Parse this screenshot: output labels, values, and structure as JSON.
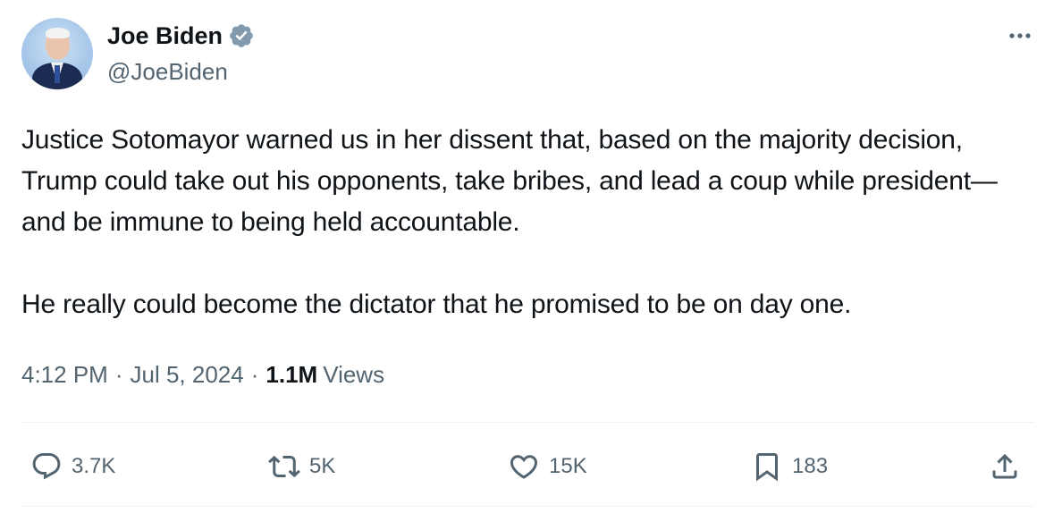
{
  "author": {
    "display_name": "Joe Biden",
    "handle": "@JoeBiden",
    "verified": true,
    "verified_color": "#829aab"
  },
  "tweet": {
    "paragraphs": [
      "Justice Sotomayor warned us in her dissent that, based on the majority decision, Trump could take out his opponents, take bribes, and lead a coup while president—and be immune to being held accountable.",
      "He really could become the dictator that he promised to be on day one."
    ],
    "time": "4:12 PM",
    "separator": "·",
    "date": "Jul 5, 2024",
    "views_count": "1.1M",
    "views_label": "Views"
  },
  "actions": {
    "reply": {
      "icon": "reply-icon",
      "count": "3.7K"
    },
    "repost": {
      "icon": "repost-icon",
      "count": "5K"
    },
    "like": {
      "icon": "heart-icon",
      "count": "15K"
    },
    "bookmark": {
      "icon": "bookmark-icon",
      "count": "183"
    },
    "share": {
      "icon": "share-icon"
    }
  },
  "colors": {
    "text_primary": "#0f1419",
    "text_secondary": "#536471",
    "divider": "#eff3f4"
  }
}
